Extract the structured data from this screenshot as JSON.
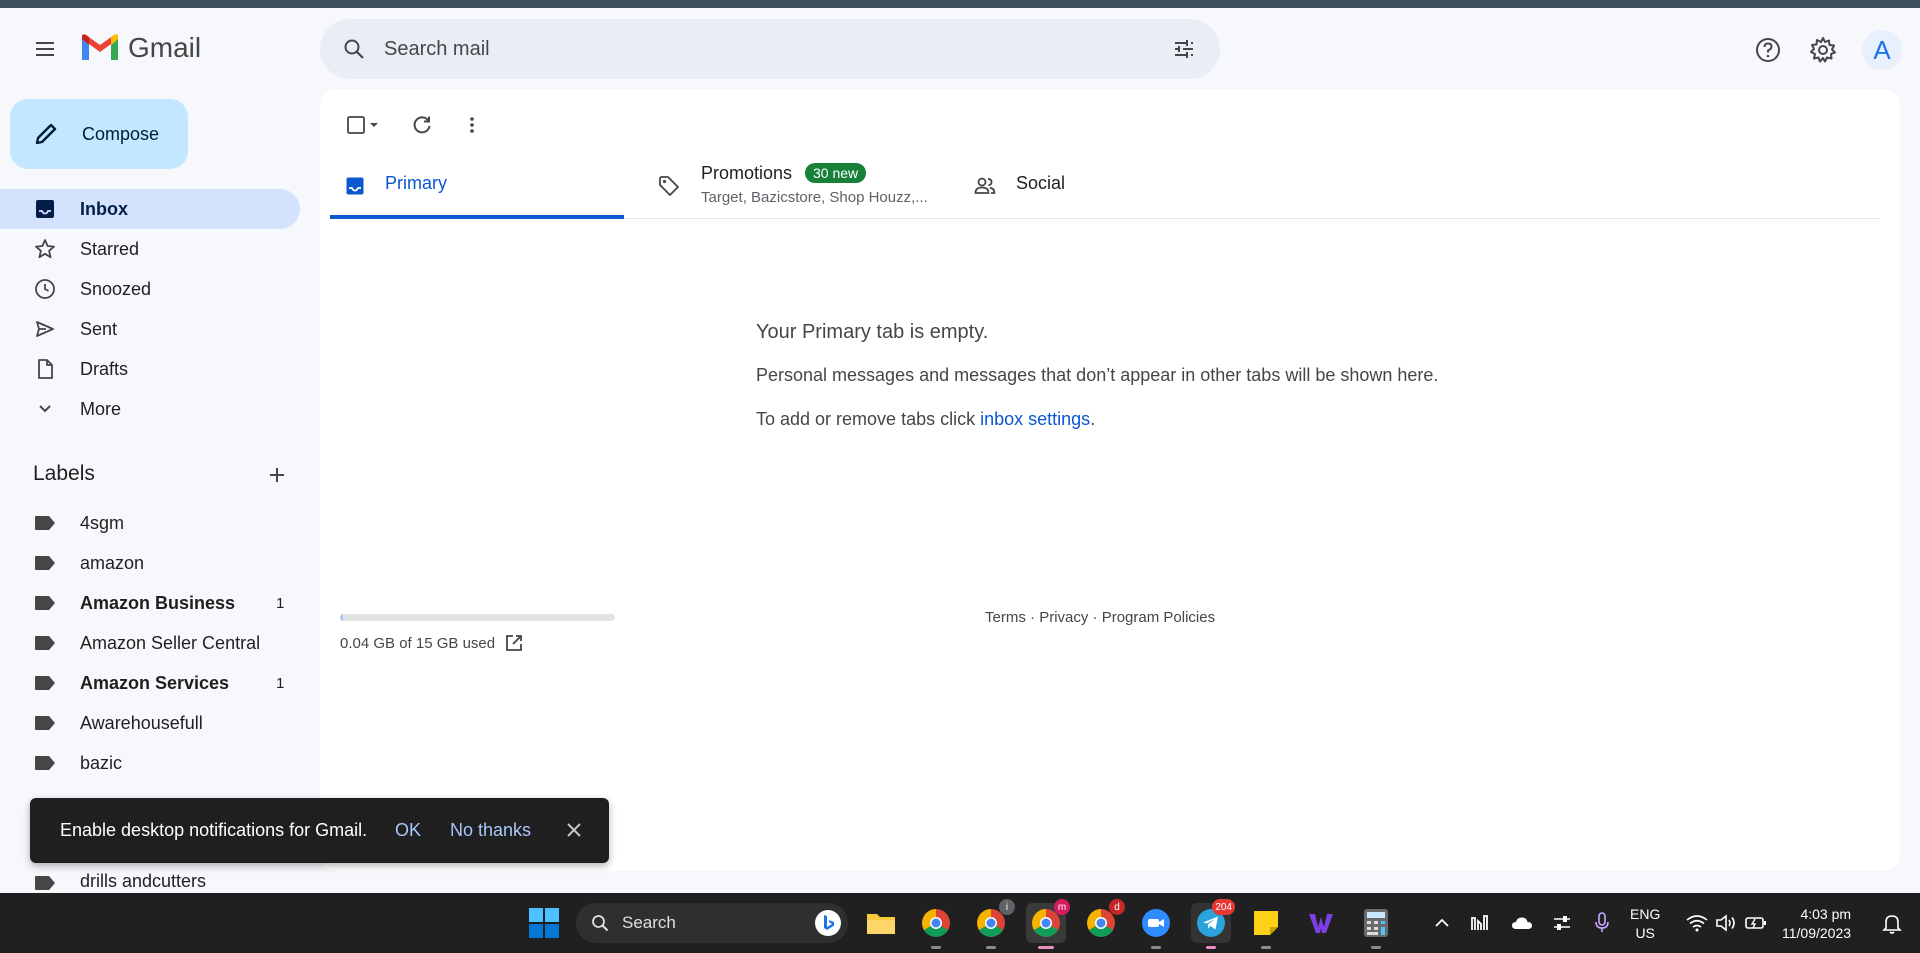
{
  "app": {
    "name": "Gmail"
  },
  "search": {
    "placeholder": "Search mail"
  },
  "header": {
    "avatar_letter": "A"
  },
  "compose": {
    "label": "Compose"
  },
  "nav": {
    "items": [
      {
        "label": "Inbox",
        "icon": "inbox-icon",
        "active": true
      },
      {
        "label": "Starred",
        "icon": "star-icon"
      },
      {
        "label": "Snoozed",
        "icon": "clock-icon"
      },
      {
        "label": "Sent",
        "icon": "send-icon"
      },
      {
        "label": "Drafts",
        "icon": "draft-icon"
      },
      {
        "label": "More",
        "icon": "chevron-down-icon"
      }
    ]
  },
  "labels": {
    "title": "Labels",
    "items": [
      {
        "label": "4sgm",
        "count": ""
      },
      {
        "label": "amazon",
        "count": ""
      },
      {
        "label": "Amazon Business",
        "count": "1",
        "bold": true
      },
      {
        "label": "Amazon Seller Central",
        "count": ""
      },
      {
        "label": "Amazon Services",
        "count": "1",
        "bold": true
      },
      {
        "label": "Awarehousefull",
        "count": ""
      },
      {
        "label": "bazic",
        "count": ""
      }
    ],
    "below_snackbar": "drills andcutters"
  },
  "tabs": {
    "primary": "Primary",
    "promotions": "Promotions",
    "promotions_badge": "30 new",
    "promotions_sub": "Target, Bazicstore, Shop Houzz,...",
    "social": "Social"
  },
  "empty": {
    "title": "Your Primary tab is empty.",
    "message": "Personal messages and messages that don’t appear in other tabs will be shown here.",
    "hint_prefix": "To add or remove tabs click ",
    "hint_link": "inbox settings",
    "hint_suffix": "."
  },
  "storage": {
    "text": "0.04 GB of 15 GB used",
    "fraction": 0.0027
  },
  "footer": {
    "terms": "Terms",
    "privacy": "Privacy",
    "policies": "Program Policies",
    "sep": " · "
  },
  "snackbar": {
    "message": "Enable desktop notifications for Gmail.",
    "ok": "OK",
    "no_thanks": "No thanks"
  },
  "taskbar": {
    "search_label": "Search",
    "lang_top": "ENG",
    "lang_bottom": "US",
    "time": "4:03 pm",
    "date": "11/09/2023",
    "telegram_badge": "204",
    "chrome_badge_1": "i",
    "chrome_badge_2": "m",
    "chrome_badge_3": "d"
  },
  "colors": {
    "accent": "#0b57d0",
    "compose_bg": "#c2e7ff",
    "active_nav": "#d3e3fd",
    "badge_green": "#188038"
  }
}
